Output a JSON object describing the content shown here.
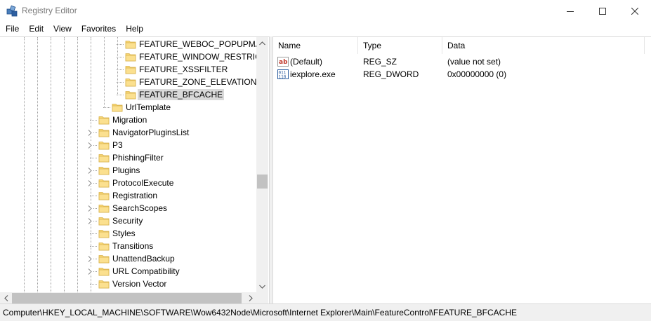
{
  "window": {
    "title": "Registry Editor",
    "icon": "regedit-icon"
  },
  "menu": [
    "File",
    "Edit",
    "View",
    "Favorites",
    "Help"
  ],
  "tree": {
    "items": [
      {
        "label": "FEATURE_WEBOC_POPUPMANA",
        "depth": 3,
        "expandable": false,
        "selected": false
      },
      {
        "label": "FEATURE_WINDOW_RESTRICTIC",
        "depth": 3,
        "expandable": false,
        "selected": false
      },
      {
        "label": "FEATURE_XSSFILTER",
        "depth": 3,
        "expandable": false,
        "selected": false
      },
      {
        "label": "FEATURE_ZONE_ELEVATION",
        "depth": 3,
        "expandable": false,
        "selected": false
      },
      {
        "label": "FEATURE_BFCACHE",
        "depth": 3,
        "expandable": false,
        "selected": true
      },
      {
        "label": "UrlTemplate",
        "depth": 2,
        "expandable": false,
        "selected": false
      },
      {
        "label": "Migration",
        "depth": 1,
        "expandable": false,
        "selected": false
      },
      {
        "label": "NavigatorPluginsList",
        "depth": 1,
        "expandable": true,
        "selected": false
      },
      {
        "label": "P3",
        "depth": 1,
        "expandable": true,
        "selected": false
      },
      {
        "label": "PhishingFilter",
        "depth": 1,
        "expandable": false,
        "selected": false
      },
      {
        "label": "Plugins",
        "depth": 1,
        "expandable": true,
        "selected": false
      },
      {
        "label": "ProtocolExecute",
        "depth": 1,
        "expandable": true,
        "selected": false
      },
      {
        "label": "Registration",
        "depth": 1,
        "expandable": false,
        "selected": false
      },
      {
        "label": "SearchScopes",
        "depth": 1,
        "expandable": true,
        "selected": false
      },
      {
        "label": "Security",
        "depth": 1,
        "expandable": true,
        "selected": false
      },
      {
        "label": "Styles",
        "depth": 1,
        "expandable": false,
        "selected": false
      },
      {
        "label": "Transitions",
        "depth": 1,
        "expandable": false,
        "selected": false
      },
      {
        "label": "UnattendBackup",
        "depth": 1,
        "expandable": true,
        "selected": false
      },
      {
        "label": "URL Compatibility",
        "depth": 1,
        "expandable": true,
        "selected": false
      },
      {
        "label": "Version Vector",
        "depth": 1,
        "expandable": false,
        "selected": false
      }
    ]
  },
  "list": {
    "columns": [
      "Name",
      "Type",
      "Data"
    ],
    "rows": [
      {
        "name": "(Default)",
        "type": "REG_SZ",
        "data": "(value not set)",
        "icon": "string-value-icon"
      },
      {
        "name": "iexplore.exe",
        "type": "REG_DWORD",
        "data": "0x00000000 (0)",
        "icon": "dword-value-icon"
      }
    ]
  },
  "status": {
    "path": "Computer\\HKEY_LOCAL_MACHINE\\SOFTWARE\\Wow6432Node\\Microsoft\\Internet Explorer\\Main\\FeatureControl\\FEATURE_BFCACHE"
  },
  "colors": {
    "folder": "#f8d775",
    "selection": "#d9d9d9",
    "chrome": "#f0f0f0"
  }
}
